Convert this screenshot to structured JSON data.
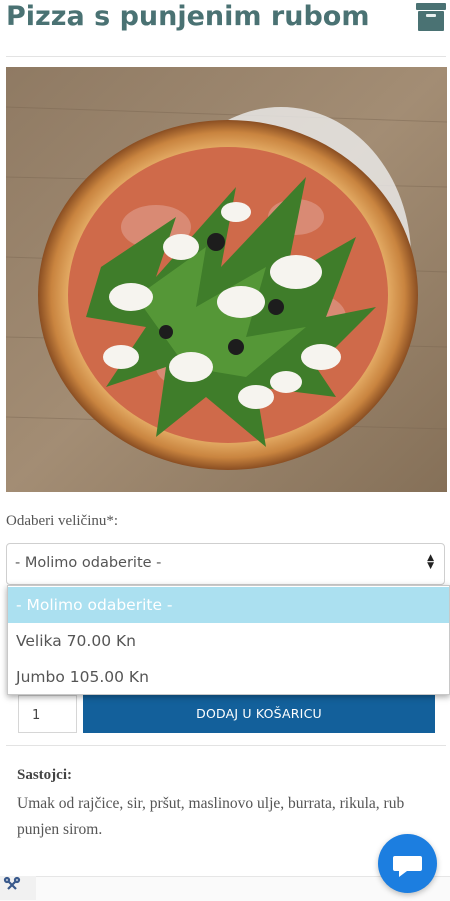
{
  "page": {
    "title": "Pizza s punjenim rubom"
  },
  "header": {
    "cart_icon": "cart-icon"
  },
  "product": {
    "image_alt": "pizza photo"
  },
  "size": {
    "label": "Odaberi veličinu*:",
    "selected": "- Molimo odaberite -",
    "options": [
      {
        "label": "- Molimo odaberite -",
        "selected": true
      },
      {
        "label": "Velika 70.00 Kn",
        "selected": false
      },
      {
        "label": "Jumbo 105.00 Kn",
        "selected": false
      }
    ]
  },
  "cart": {
    "quantity": "1",
    "add_label": "DODAJ U KOŠARICU"
  },
  "ingredients": {
    "title": "Sastojci:",
    "text": "Umak od rajčice, sir, pršut, maslinovo ulje, burrata, rikula, rub punjen sirom."
  },
  "colors": {
    "title": "#4a7273",
    "button": "#13609b",
    "highlight": "#abe0f0",
    "chat": "#1c7ee0"
  }
}
